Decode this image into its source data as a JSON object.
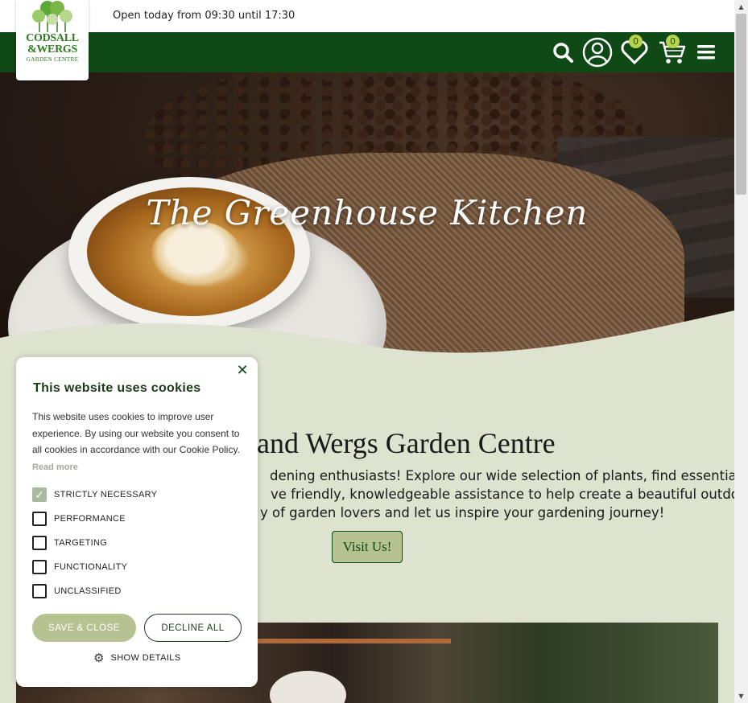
{
  "header": {
    "opening_hours": "Open today from 09:30 until 17:30",
    "logo": {
      "line1": "CODSALL",
      "line2": "&WERGS",
      "line3": "GARDEN CENTRE"
    },
    "icons": {
      "search": "search-icon",
      "account": "user-account-icon",
      "wishlist": "heart-icon",
      "cart": "shopping-cart-icon",
      "menu": "hamburger-menu-icon"
    },
    "wishlist_count": "0",
    "cart_count": "0",
    "brand_color": "#0f4a16",
    "badge_color": "#b7d24b"
  },
  "hero": {
    "title": "The Greenhouse Kitchen"
  },
  "main": {
    "heading": "ll and Wergs Garden Centre",
    "paragraph_lines": [
      "dening enthusiasts! Explore our wide selection of plants, find essential",
      "ve friendly, knowledgeable assistance to help create a beautiful outdoor",
      "y of garden lovers and let us inspire your gardening journey!"
    ],
    "visit_button": "Visit Us!",
    "background_color": "#dde3cf"
  },
  "cookie_banner": {
    "title": "This website uses cookies",
    "description": "This website uses cookies to improve user experience. By using our website you consent to all cookies in accordance with our Cookie Policy.",
    "read_more": "Read more",
    "options": [
      {
        "label": "STRICTLY NECESSARY",
        "checked": true
      },
      {
        "label": "PERFORMANCE",
        "checked": false
      },
      {
        "label": "TARGETING",
        "checked": false
      },
      {
        "label": "FUNCTIONALITY",
        "checked": false
      },
      {
        "label": "UNCLASSIFIED",
        "checked": false
      }
    ],
    "save_button": "SAVE & CLOSE",
    "decline_button": "DECLINE ALL",
    "show_details": "SHOW DETAILS",
    "close_icon": "close-icon",
    "gear_icon": "gear-icon"
  }
}
